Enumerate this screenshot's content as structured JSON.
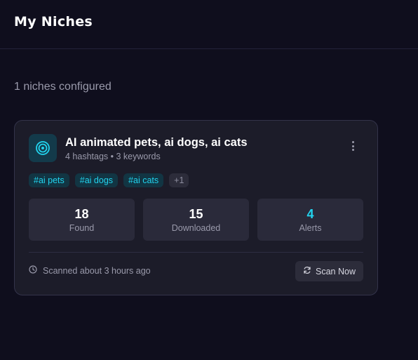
{
  "header": {
    "title": "My Niches"
  },
  "summary": {
    "text": "1 niches configured"
  },
  "niche": {
    "icon": "target-icon",
    "title": "AI animated pets, ai dogs, ai cats",
    "meta": "4 hashtags • 3 keywords",
    "tags": [
      "#ai pets",
      "#ai dogs",
      "#ai cats"
    ],
    "more_tags": "+1",
    "stats": [
      {
        "value": "18",
        "label": "Found"
      },
      {
        "value": "15",
        "label": "Downloaded"
      },
      {
        "value": "4",
        "label": "Alerts"
      }
    ],
    "scanned_text": "Scanned about 3 hours ago",
    "scan_button": "Scan Now"
  },
  "colors": {
    "background": "#0f0e1d",
    "card": "#1c1c29",
    "accent": "#22d3ee"
  }
}
